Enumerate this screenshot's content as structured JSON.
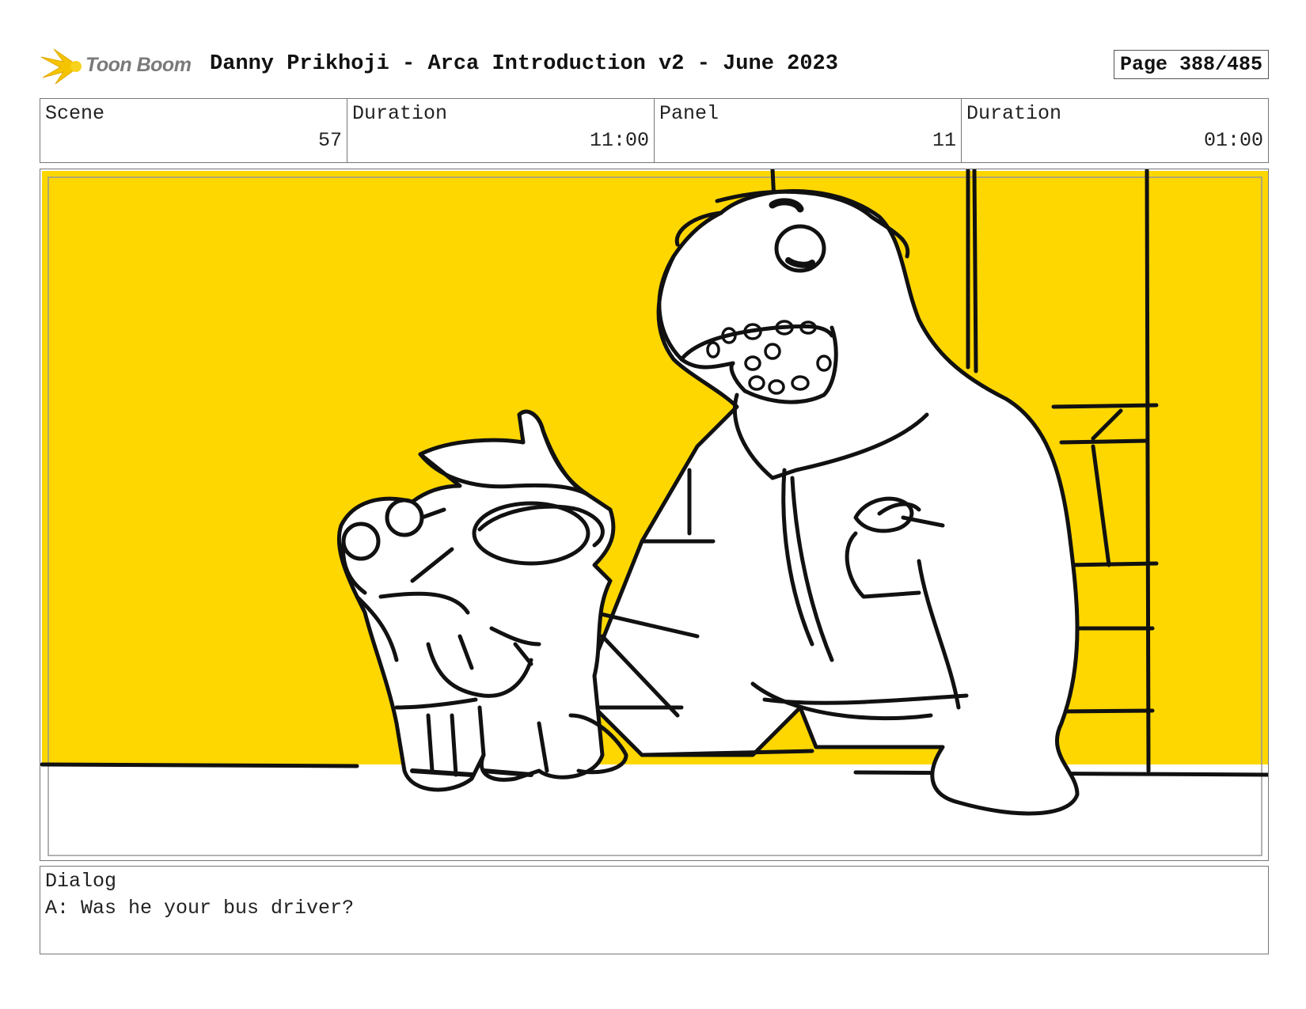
{
  "header": {
    "logo_text": "Toon Boom",
    "title": "Danny Prikhoji - Arca Introduction v2 - June 2023",
    "page": "Page 388/485"
  },
  "info": {
    "scene_label": "Scene",
    "scene_value": "57",
    "scene_duration_label": "Duration",
    "scene_duration_value": "11:00",
    "panel_label": "Panel",
    "panel_value": "11",
    "panel_duration_label": "Duration",
    "panel_duration_value": "01:00"
  },
  "panel": {
    "background_color": "#FFD700",
    "floor_color": "#FFFFFF",
    "line_color": "#111111"
  },
  "dialog": {
    "label": "Dialog",
    "text": "A: Was he your bus driver?"
  }
}
